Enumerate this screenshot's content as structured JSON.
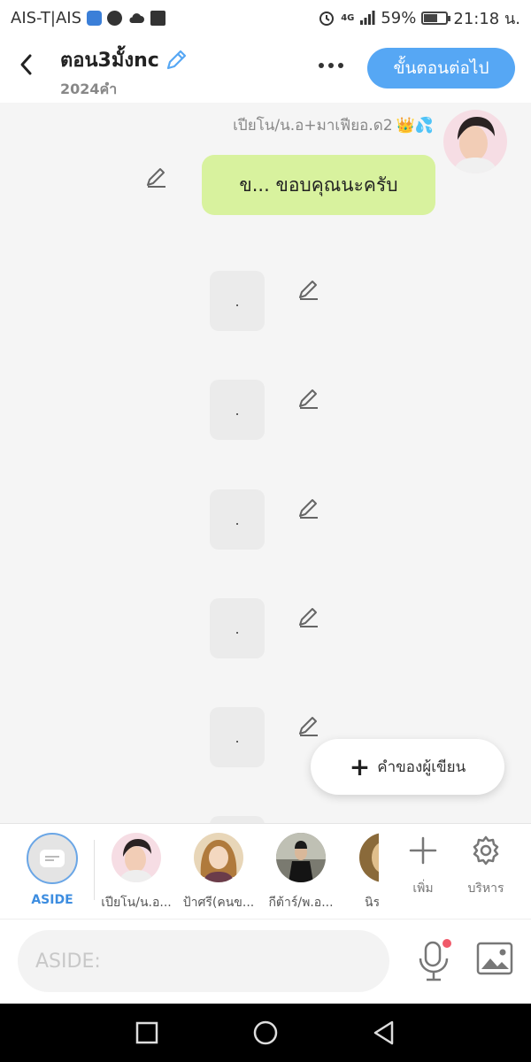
{
  "status_bar": {
    "carrier": "AIS-T|AIS",
    "network": "4G",
    "battery": "59%",
    "battery_level": 0.59,
    "time": "21:18 น."
  },
  "header": {
    "title": "ตอน3มั้งnc",
    "word_count": "2024คำ",
    "next_button": "ขั้นตอนต่อไป"
  },
  "chat": {
    "sender_name": "เปียโน/น.อ+มาเฟียอ.ด2",
    "sender_emoji": "👑💦",
    "message_text": "ข... ขอบคุณนะครับ",
    "dot_messages": [
      ".",
      ".",
      ".",
      ".",
      "."
    ]
  },
  "fab": {
    "label": "คำของผู้เขียน"
  },
  "characters": {
    "aside_label": "ASIDE",
    "items": [
      {
        "label": "เปียโน/น.อ..."
      },
      {
        "label": "ป้าศรี(คนข..."
      },
      {
        "label": "กีต้าร์/พ.อ..."
      },
      {
        "label": "นิร"
      }
    ],
    "add_label": "เพิ่ม",
    "manage_label": "บริหาร"
  },
  "input": {
    "placeholder": "ASIDE:"
  },
  "colors": {
    "accent": "#56a7f4",
    "message_bubble": "#d8f29e",
    "aside_accent": "#3d8de0"
  }
}
